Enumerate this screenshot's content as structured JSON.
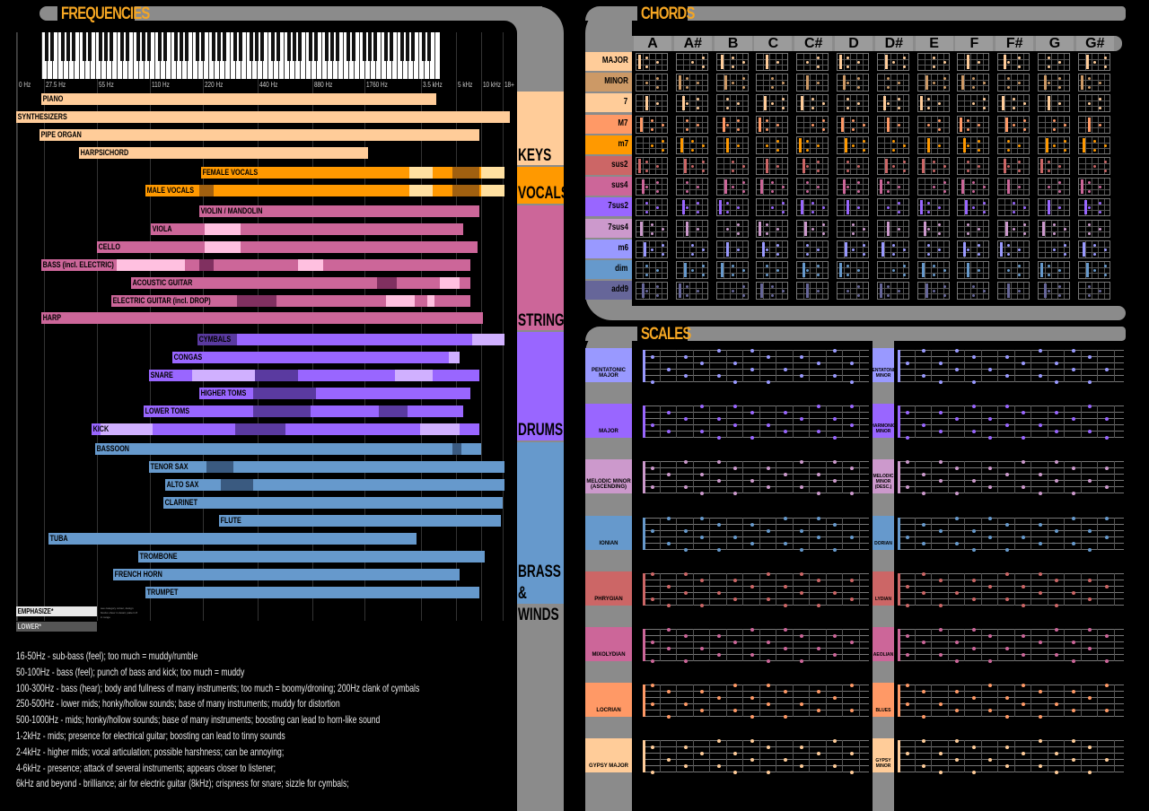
{
  "frequencies": {
    "title": "FREQUENCIES",
    "axis_labels": [
      "0 Hz",
      "27.5 Hz",
      "55 Hz",
      "110 Hz",
      "220 Hz",
      "440 Hz",
      "880 Hz",
      "1760 Hz",
      "3.5 kHz",
      "5 kHz",
      "10 kHz",
      "18+"
    ],
    "instruments": [
      {
        "label": "PIANO",
        "color": "#ffcc99"
      },
      {
        "label": "SYNTHESIZERS",
        "color": "#ffcc99"
      },
      {
        "label": "PIPE ORGAN",
        "color": "#ffcc99"
      },
      {
        "label": "HARPSICHORD",
        "color": "#ffcc99"
      },
      {
        "label": "FEMALE VOCALS",
        "color": "#ff9900"
      },
      {
        "label": "MALE VOCALS",
        "color": "#ff9900"
      },
      {
        "label": "VIOLIN / MANDOLIN",
        "color": "#cc6699"
      },
      {
        "label": "VIOLA",
        "color": "#cc6699"
      },
      {
        "label": "CELLO",
        "color": "#cc6699"
      },
      {
        "label": "BASS (incl. ELECTRIC)",
        "color": "#cc6699"
      },
      {
        "label": "ACOUSTIC GUITAR",
        "color": "#cc6699"
      },
      {
        "label": "ELECTRIC GUITAR (incl. DROP)",
        "color": "#cc6699"
      },
      {
        "label": "HARP",
        "color": "#cc6699"
      },
      {
        "label": "CYMBALS",
        "color": "#9966ff"
      },
      {
        "label": "CONGAS",
        "color": "#9966ff"
      },
      {
        "label": "SNARE",
        "color": "#9966ff"
      },
      {
        "label": "HIGHER TOMS",
        "color": "#9966ff"
      },
      {
        "label": "LOWER TOMS",
        "color": "#9966ff"
      },
      {
        "label": "KICK",
        "color": "#9966ff"
      },
      {
        "label": "BASSOON",
        "color": "#6699cc"
      },
      {
        "label": "TENOR SAX",
        "color": "#6699cc"
      },
      {
        "label": "ALTO SAX",
        "color": "#6699cc"
      },
      {
        "label": "CLARINET",
        "color": "#6699cc"
      },
      {
        "label": "FLUTE",
        "color": "#6699cc"
      },
      {
        "label": "TUBA",
        "color": "#6699cc"
      },
      {
        "label": "TROMBONE",
        "color": "#6699cc"
      },
      {
        "label": "FRENCH HORN",
        "color": "#6699cc"
      },
      {
        "label": "TRUMPET",
        "color": "#6699cc"
      }
    ],
    "categories": [
      {
        "label": "KEYS",
        "color": "#ffcc99"
      },
      {
        "label": "VOCALS",
        "color": "#ff9900"
      },
      {
        "label": "STRINGS",
        "color": "#cc6699"
      },
      {
        "label": "DRUMS",
        "color": "#9966ff"
      },
      {
        "label": "BRASS & WINDS",
        "color": "#6699cc"
      }
    ],
    "legend": {
      "emphasize": "EMPHASIZE*",
      "lower": "LOWER*",
      "note": "see category colour, design blocks show in detail, pattern 8 in range"
    },
    "notes": [
      "16-50Hz - sub-bass (feel); too much = muddy/rumble",
      "50-100Hz - bass (feel); punch of bass and kick; too much = muddy",
      "100-300Hz - bass (hear); body and fullness of many instruments; too much = boomy/droning; 200Hz clank of cymbals",
      "250-500Hz - lower mids; honky/hollow sounds; base of many instruments; muddy for distortion",
      "500-1000Hz - mids; honky/hollow sounds; base of many instruments; boosting can lead to horn-like sound",
      "1-2kHz - mids; presence for electrical guitar; boosting can lead to tinny sounds",
      "2-4kHz - higher mids; vocal articulation; possible harshness; can be annoying;",
      "4-6kHz - presence; attack of several instruments; appears closer to listener;",
      "6kHz and beyond - brilliance; air for electric guitar (8kHz); crispness for snare; sizzle for cymbals;"
    ]
  },
  "chords": {
    "title": "CHORDS",
    "notes": [
      "A",
      "A#",
      "B",
      "C",
      "C#",
      "D",
      "D#",
      "E",
      "F",
      "F#",
      "G",
      "G#"
    ],
    "types": [
      {
        "label": "MAJOR",
        "color": "#ffcc99"
      },
      {
        "label": "MINOR",
        "color": "#cc9966"
      },
      {
        "label": "7",
        "color": "#ffcc99"
      },
      {
        "label": "M7",
        "color": "#ff9966"
      },
      {
        "label": "m7",
        "color": "#ff9900"
      },
      {
        "label": "sus2",
        "color": "#cc6666"
      },
      {
        "label": "sus4",
        "color": "#cc6699"
      },
      {
        "label": "7sus2",
        "color": "#9966ff"
      },
      {
        "label": "7sus4",
        "color": "#cc99cc"
      },
      {
        "label": "m6",
        "color": "#9999ff"
      },
      {
        "label": "dim",
        "color": "#6699cc"
      },
      {
        "label": "add9",
        "color": "#666699"
      }
    ]
  },
  "scales": {
    "title": "SCALES",
    "left": [
      {
        "label": "PENTATONIC MAJOR",
        "color": "#9999ff"
      },
      {
        "label": "MAJOR",
        "color": "#9966ff"
      },
      {
        "label": "MELODIC MINOR (ASCENDING)",
        "color": "#cc99cc"
      },
      {
        "label": "IONIAN",
        "color": "#6699cc"
      },
      {
        "label": "PHRYGIAN",
        "color": "#cc6666"
      },
      {
        "label": "MIXOLYDIAN",
        "color": "#cc6699"
      },
      {
        "label": "LOCRIAN",
        "color": "#ff9966"
      },
      {
        "label": "GYPSY MAJOR",
        "color": "#ffcc99"
      }
    ],
    "right": [
      {
        "label": "PENTATONIC MINOR",
        "color": "#9999ff"
      },
      {
        "label": "HARMONIC MINOR",
        "color": "#9966ff"
      },
      {
        "label": "MELODIC MINOR (DESC.)",
        "color": "#cc99cc"
      },
      {
        "label": "DORIAN",
        "color": "#6699cc"
      },
      {
        "label": "LYDIAN",
        "color": "#cc6666"
      },
      {
        "label": "AEOLIAN",
        "color": "#cc6699"
      },
      {
        "label": "BLUES",
        "color": "#ff9966"
      },
      {
        "label": "GYPSY MINOR",
        "color": "#ffcc99"
      }
    ]
  }
}
